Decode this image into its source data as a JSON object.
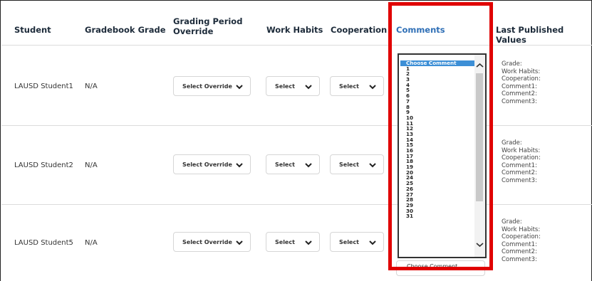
{
  "headers": {
    "student": "Student",
    "gradebook_grade": "Gradebook Grade",
    "grading_period_override": "Grading Period Override",
    "work_habits": "Work Habits",
    "cooperation": "Cooperation",
    "comments": "Comments",
    "last_published_values": "Last Published Values"
  },
  "rows": [
    {
      "student": "LAUSD Student1",
      "grade": "N/A",
      "override": "Select Override",
      "work_habits": "Select",
      "cooperation": "Select",
      "last_published": [
        "Grade:",
        "Work Habits:",
        "Cooperation:",
        "Comment1:",
        "Comment2:",
        "Comment3:"
      ]
    },
    {
      "student": "LAUSD Student2",
      "grade": "N/A",
      "override": "Select Override",
      "work_habits": "Select",
      "cooperation": "Select",
      "last_published": [
        "Grade:",
        "Work Habits:",
        "Cooperation:",
        "Comment1:",
        "Comment2:",
        "Comment3:"
      ]
    },
    {
      "student": "LAUSD Student5",
      "grade": "N/A",
      "override": "Select Override",
      "work_habits": "Select",
      "cooperation": "Select",
      "last_published": [
        "Grade:",
        "Work Habits:",
        "Cooperation:",
        "Comment1:",
        "Comment2:",
        "Comment3:"
      ]
    }
  ],
  "comment_dropdown": {
    "selected": "Choose Comment",
    "options": [
      "Choose Comment",
      "1",
      "2",
      "3",
      "4",
      "5",
      "6",
      "7",
      "8",
      "9",
      "10",
      "11",
      "12",
      "13",
      "14",
      "15",
      "16",
      "17",
      "18",
      "19",
      "20",
      "24",
      "25",
      "26",
      "27",
      "28",
      "29",
      "30",
      "31"
    ]
  },
  "comment_select_peek": "Choose Comment",
  "colors": {
    "highlight": "#e00000",
    "selected_option": "#3d8fd6",
    "header_link": "#2f6fb6"
  },
  "icons": {
    "chevron": "chevron-down-icon",
    "scroll_up": "scroll-up-arrow-icon",
    "scroll_down": "scroll-down-arrow-icon"
  }
}
